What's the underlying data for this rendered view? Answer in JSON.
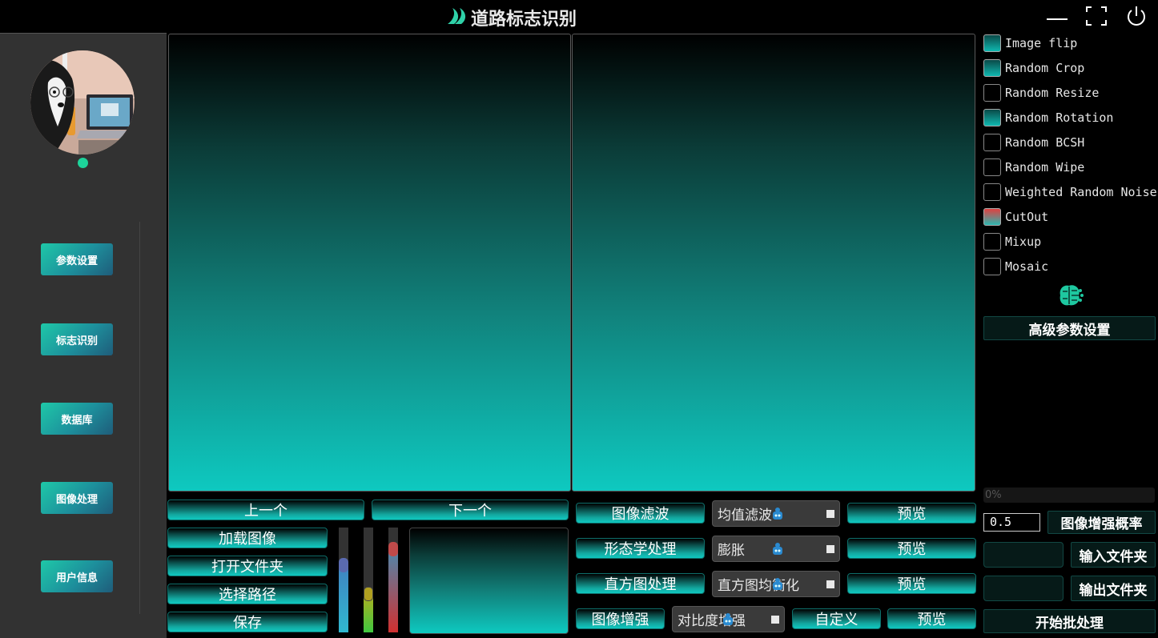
{
  "window": {
    "title": "道路标志识别"
  },
  "sidebar": {
    "nav": [
      {
        "label": "参数设置"
      },
      {
        "label": "标志识别"
      },
      {
        "label": "数据库"
      },
      {
        "label": "图像处理"
      },
      {
        "label": "用户信息"
      }
    ],
    "status_color": "#1dd39a"
  },
  "viewer": {
    "prev_label": "上一个",
    "next_label": "下一个"
  },
  "file_actions": {
    "load_image": "加载图像",
    "open_folder": "打开文件夹",
    "select_path": "选择路径",
    "save": "保存"
  },
  "sliders": [
    {
      "channel": "blue",
      "level": 0.67
    },
    {
      "channel": "green",
      "level": 0.37
    },
    {
      "channel": "red",
      "level": 0.82
    }
  ],
  "processing": {
    "filter": {
      "label": "图像滤波",
      "selected": "均值滤波",
      "preview": "预览"
    },
    "morphology": {
      "label": "形态学处理",
      "selected": "膨胀",
      "preview": "预览"
    },
    "histogram": {
      "label": "直方图处理",
      "selected": "直方图均衡化",
      "preview": "预览"
    },
    "enhance": {
      "label": "图像增强",
      "selected": "对比度增强",
      "custom": "自定义",
      "preview": "预览"
    }
  },
  "augmentations": [
    {
      "label": "Image flip",
      "state": "checked"
    },
    {
      "label": "Random Crop",
      "state": "checked"
    },
    {
      "label": "Random Resize",
      "state": "unchecked"
    },
    {
      "label": "Random Rotation",
      "state": "checked"
    },
    {
      "label": "Random BCSH",
      "state": "unchecked"
    },
    {
      "label": "Random Wipe",
      "state": "unchecked"
    },
    {
      "label": "Weighted Random Noise",
      "state": "unchecked"
    },
    {
      "label": "CutOut",
      "state": "partial"
    },
    {
      "label": "Mixup",
      "state": "unchecked"
    },
    {
      "label": "Mosaic",
      "state": "unchecked"
    }
  ],
  "batch": {
    "advanced_settings": "高级参数设置",
    "progress_text": "0%",
    "probability_value": "0.5",
    "probability_label": "图像增强概率",
    "input_folder": "输入文件夹",
    "output_folder": "输出文件夹",
    "start": "开始批处理"
  },
  "colors": {
    "accent": "#10c8c0",
    "nav_gradient_start": "#1ec8a8",
    "nav_gradient_end": "#1f5c7a"
  }
}
